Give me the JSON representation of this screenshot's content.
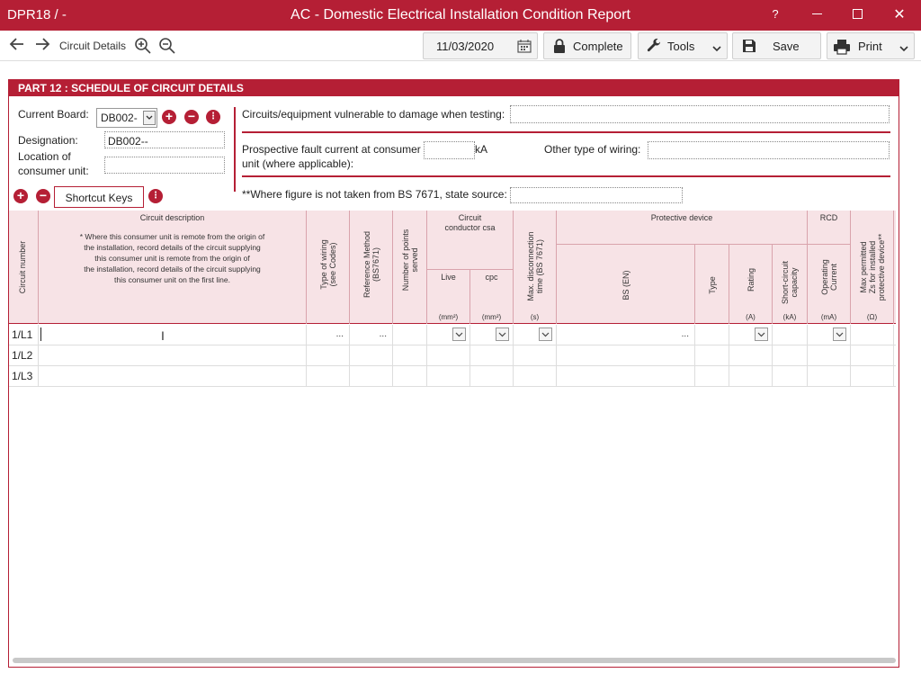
{
  "titlebar": {
    "app_id": "DPR18 / -",
    "title": "AC - Domestic Electrical Installation Condition Report",
    "help": "?",
    "close": "✕"
  },
  "toolbar": {
    "breadcrumb": "Circuit Details",
    "date": "11/03/2020",
    "complete_label": "Complete",
    "tools_label": "Tools",
    "save_label": "Save",
    "print_label": "Print"
  },
  "section": {
    "title": "PART 12 : SCHEDULE OF CIRCUIT DETAILS",
    "current_board_label": "Current Board:",
    "current_board_value": "DB002-",
    "designation_label": "Designation:",
    "designation_value": "DB002--",
    "location_label_1": "Location of",
    "location_label_2": "consumer unit:",
    "location_value": "",
    "vulnerable_label": "Circuits/equipment vulnerable to damage when testing:",
    "vulnerable_value": "",
    "fault_label_1": "Prospective fault current at consumer",
    "fault_label_2": "unit (where applicable):",
    "fault_value": "",
    "fault_unit": "kA",
    "other_wiring_label": "Other type of wiring:",
    "other_wiring_value": "",
    "source_label": "**Where figure is not taken from BS 7671, state source:",
    "source_value": "",
    "shortcut_keys_label": "Shortcut Keys"
  },
  "table": {
    "headers": {
      "circuit_number": "Circuit number",
      "circuit_description": "Circuit description",
      "description_note_1": "* Where this consumer unit is remote from the origin of",
      "description_note_2": "the installation, record details of the circuit supplying",
      "description_note_3": "this consumer unit is remote from the origin of",
      "description_note_4": "the installation, record details of the circuit supplying",
      "description_note_5": "this consumer unit on the first line.",
      "type_of_wiring_1": "Type of wiring",
      "type_of_wiring_2": "(see Codes)",
      "reference_method_1": "Reference Method",
      "reference_method_2": "(BS7671)",
      "points_served_1": "Number of points",
      "points_served_2": "served",
      "conductor_csa_1": "Circuit",
      "conductor_csa_2": "conductor csa",
      "live": "Live",
      "cpc": "cpc",
      "unit_mm2": "(mm²)",
      "max_disconnection_1": "Max. disconnection",
      "max_disconnection_2": "time (BS 7671)",
      "unit_s": "(s)",
      "protective_device": "Protective device",
      "bs_en": "BS (EN)",
      "type": "Type",
      "rating": "Rating",
      "unit_a": "(A)",
      "short_circuit_1": "Short-circuit",
      "short_circuit_2": "capacity",
      "unit_ka": "(kA)",
      "rcd": "RCD",
      "operating_current_1": "Operating",
      "operating_current_2": "Current",
      "unit_ma": "(mA)",
      "max_zs_1": "Max permitted",
      "max_zs_2": "Zs for installed",
      "max_zs_3": "protective device**",
      "unit_ohm": "(Ω)"
    },
    "rows": [
      {
        "circuit": "1/L1",
        "ellipsis": "..."
      },
      {
        "circuit": "1/L2"
      },
      {
        "circuit": "1/L3"
      }
    ]
  }
}
